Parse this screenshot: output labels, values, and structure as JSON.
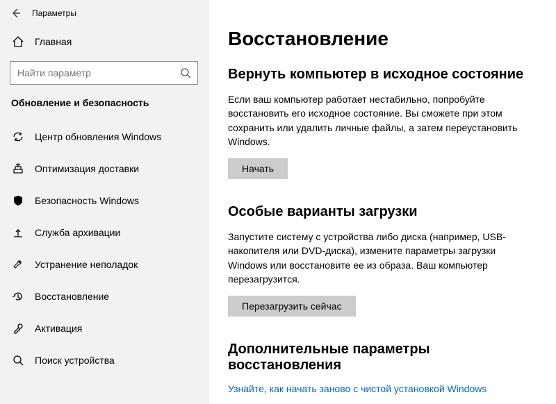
{
  "titlebar": {
    "title": "Параметры"
  },
  "sidebar": {
    "home_label": "Главная",
    "search_placeholder": "Найти параметр",
    "group_header": "Обновление и безопасность",
    "items": [
      {
        "icon": "sync-icon",
        "label": "Центр обновления Windows"
      },
      {
        "icon": "delivery-icon",
        "label": "Оптимизация доставки"
      },
      {
        "icon": "shield-icon",
        "label": "Безопасность Windows"
      },
      {
        "icon": "backup-icon",
        "label": "Служба архивации"
      },
      {
        "icon": "troubleshoot-icon",
        "label": "Устранение неполадок"
      },
      {
        "icon": "recovery-icon",
        "label": "Восстановление"
      },
      {
        "icon": "activation-icon",
        "label": "Активация"
      },
      {
        "icon": "findmydevice-icon",
        "label": "Поиск устройства"
      }
    ]
  },
  "content": {
    "page_title": "Восстановление",
    "reset": {
      "heading": "Вернуть компьютер в исходное состояние",
      "body": "Если ваш компьютер работает нестабильно, попробуйте восстановить его исходное состояние. Вы сможете при этом сохранить или удалить личные файлы, а затем переустановить Windows.",
      "button": "Начать"
    },
    "advanced_startup": {
      "heading": "Особые варианты загрузки",
      "body": "Запустите систему с устройства либо диска (например, USB-накопителя или DVD-диска), измените параметры загрузки Windows или восстановите ее из образа. Ваш компьютер перезагрузится.",
      "button": "Перезагрузить сейчас"
    },
    "more_options": {
      "heading": "Дополнительные параметры восстановления",
      "link": "Узнайте, как начать заново с чистой установкой Windows"
    }
  }
}
